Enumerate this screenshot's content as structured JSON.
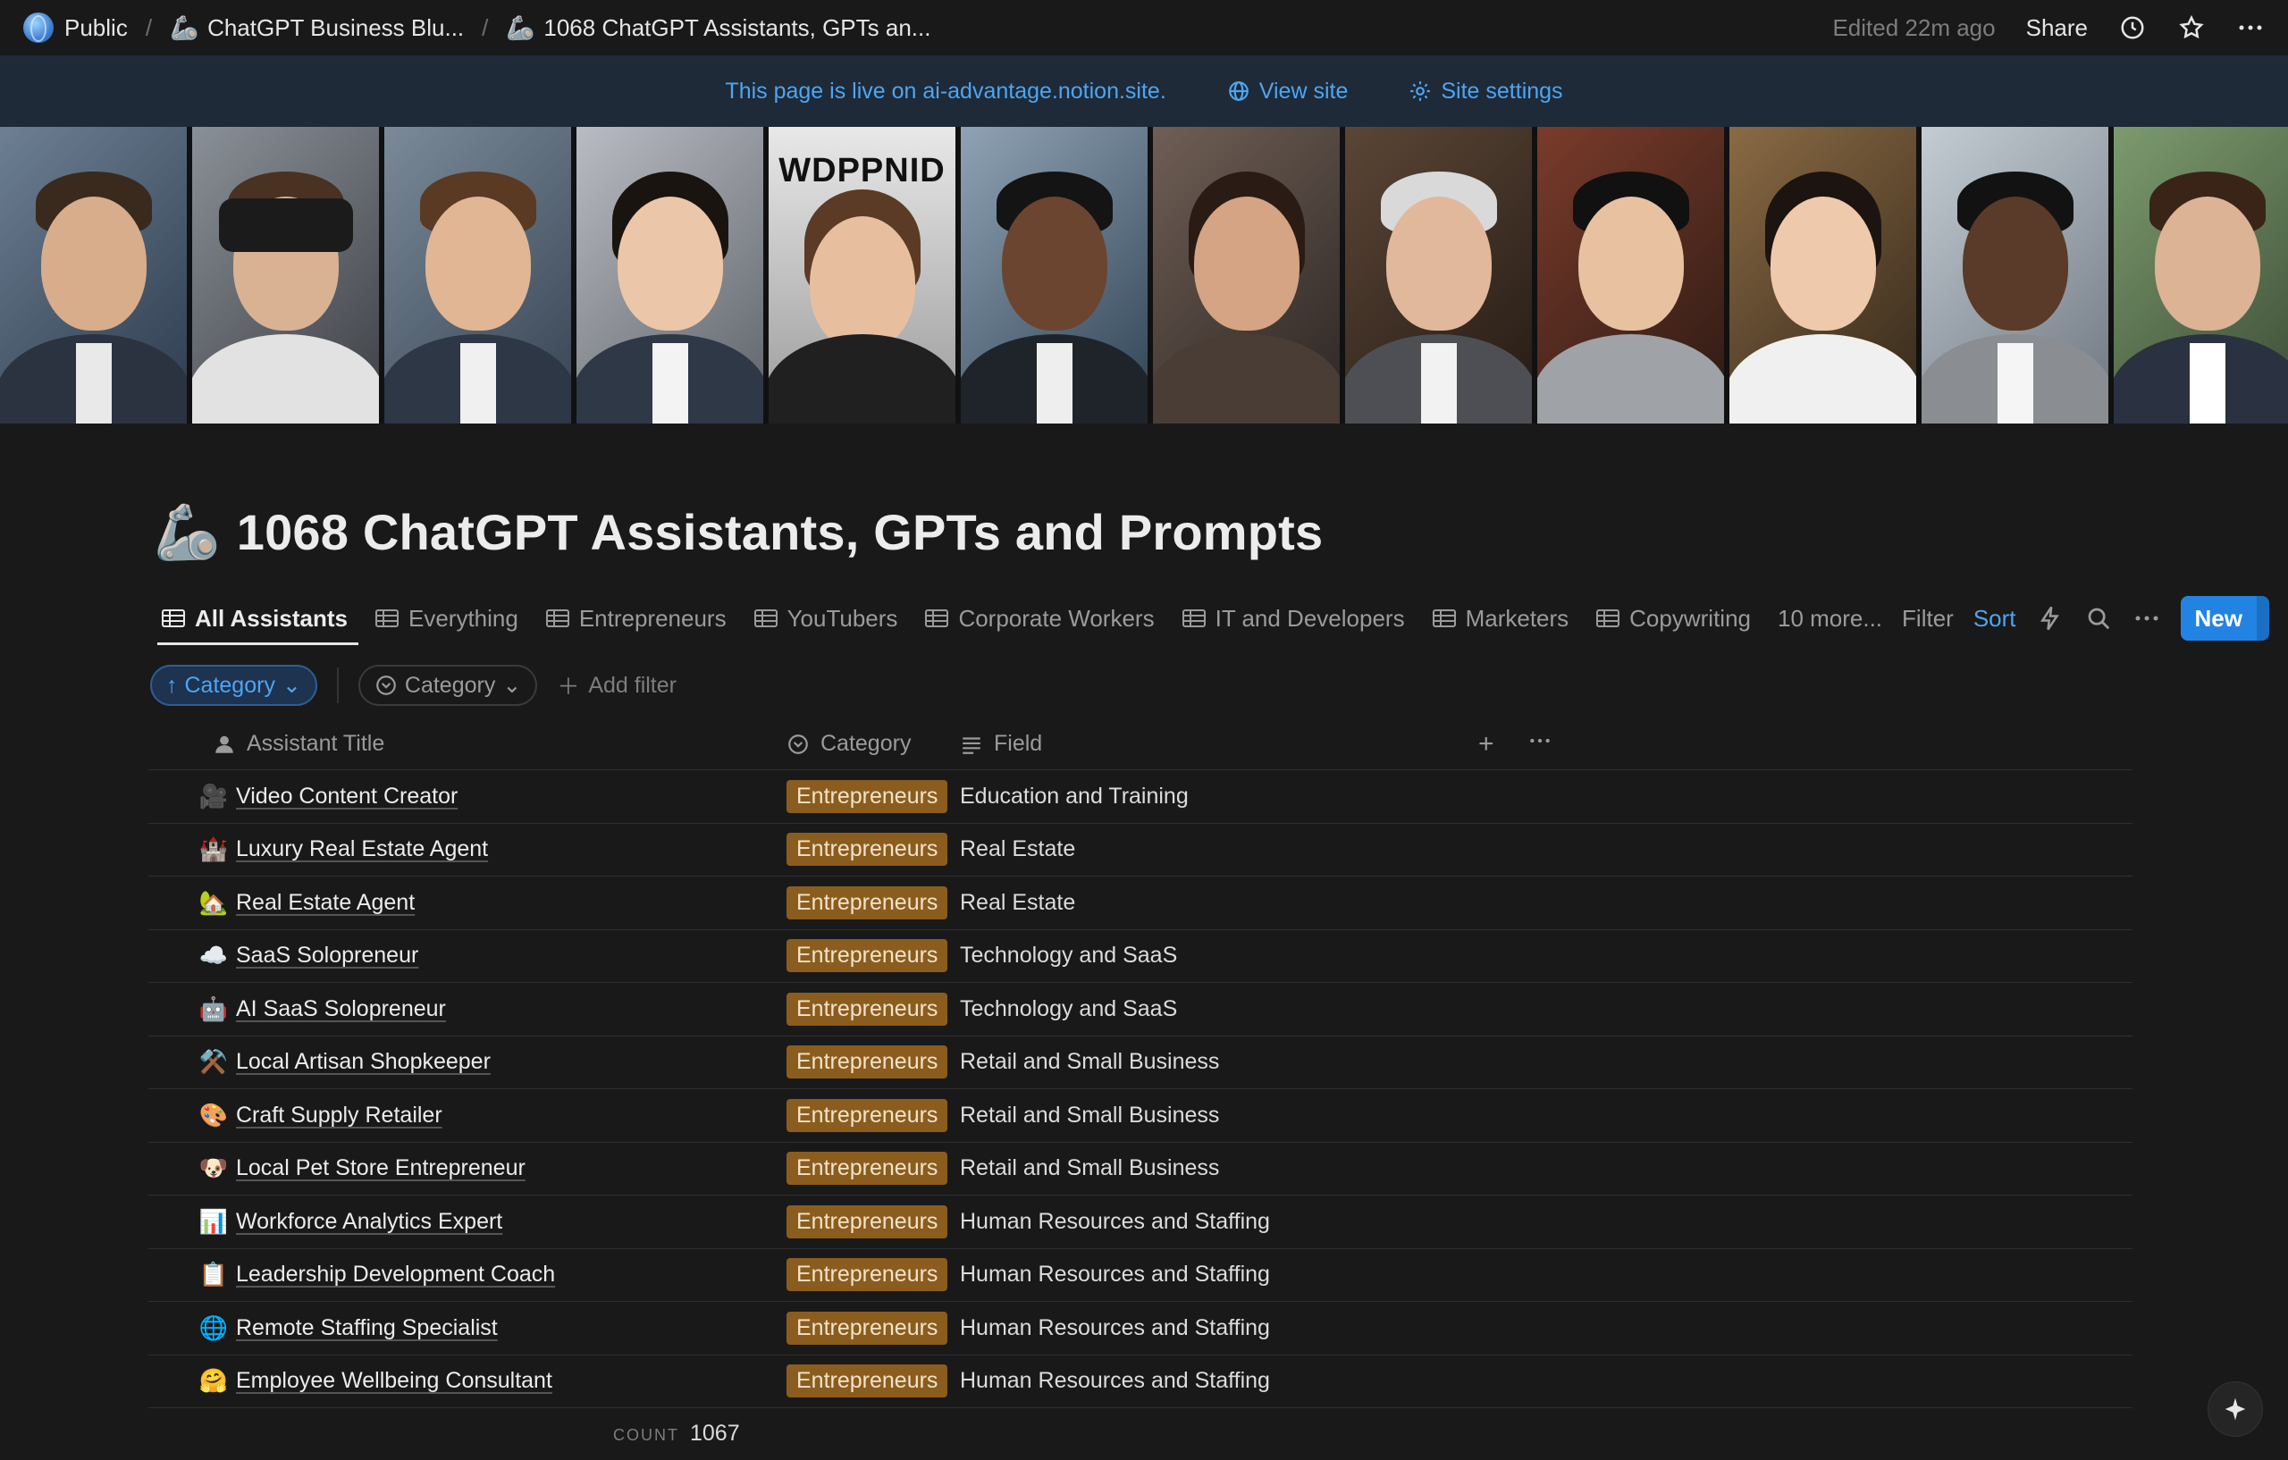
{
  "breadcrumbs": [
    {
      "emoji": "",
      "label": "Public"
    },
    {
      "emoji": "🦾",
      "label": "ChatGPT Business Blu..."
    },
    {
      "emoji": "🦾",
      "label": "1068 ChatGPT Assistants, GPTs an..."
    }
  ],
  "topbar": {
    "edited": "Edited 22m ago",
    "share_label": "Share"
  },
  "livebar": {
    "message": "This page is live on ai-advantage.notion.site.",
    "view_site": "View site",
    "site_settings": "Site settings"
  },
  "cover": {
    "wordmark": "WDPPNID"
  },
  "page": {
    "emoji": "🦾",
    "title": "1068 ChatGPT Assistants, GPTs and Prompts"
  },
  "tabs": [
    {
      "label": "All Assistants",
      "active": true
    },
    {
      "label": "Everything"
    },
    {
      "label": "Entrepreneurs"
    },
    {
      "label": "YouTubers"
    },
    {
      "label": "Corporate Workers"
    },
    {
      "label": "IT and Developers"
    },
    {
      "label": "Marketers"
    },
    {
      "label": "Copywriting"
    }
  ],
  "tab_actions": {
    "more": "10 more...",
    "filter": "Filter",
    "sort": "Sort",
    "new": "New"
  },
  "filters": {
    "sort_chip": "Category",
    "filter_chip": "Category",
    "add_filter": "Add filter"
  },
  "columns": {
    "title": "Assistant Title",
    "category": "Category",
    "field": "Field"
  },
  "rows": [
    {
      "emoji": "🎥",
      "title": "Video Content Creator",
      "category": "Entrepreneurs",
      "field": "Education and Training"
    },
    {
      "emoji": "🏰",
      "title": "Luxury Real Estate Agent",
      "category": "Entrepreneurs",
      "field": "Real Estate"
    },
    {
      "emoji": "🏡",
      "title": "Real Estate Agent",
      "category": "Entrepreneurs",
      "field": "Real Estate"
    },
    {
      "emoji": "☁️",
      "title": "SaaS Solopreneur",
      "category": "Entrepreneurs",
      "field": "Technology and SaaS"
    },
    {
      "emoji": "🤖",
      "title": "AI SaaS Solopreneur",
      "category": "Entrepreneurs",
      "field": "Technology and SaaS"
    },
    {
      "emoji": "⚒️",
      "title": "Local Artisan Shopkeeper",
      "category": "Entrepreneurs",
      "field": "Retail and Small Business"
    },
    {
      "emoji": "🎨",
      "title": "Craft Supply Retailer",
      "category": "Entrepreneurs",
      "field": "Retail and Small Business"
    },
    {
      "emoji": "🐶",
      "title": "Local Pet Store Entrepreneur",
      "category": "Entrepreneurs",
      "field": "Retail and Small Business"
    },
    {
      "emoji": "📊",
      "title": "Workforce Analytics Expert",
      "category": "Entrepreneurs",
      "field": "Human Resources and Staffing"
    },
    {
      "emoji": "📋",
      "title": "Leadership Development Coach",
      "category": "Entrepreneurs",
      "field": "Human Resources and Staffing"
    },
    {
      "emoji": "🌐",
      "title": "Remote Staffing Specialist",
      "category": "Entrepreneurs",
      "field": "Human Resources and Staffing"
    },
    {
      "emoji": "🤗",
      "title": "Employee Wellbeing Consultant",
      "category": "Entrepreneurs",
      "field": "Human Resources and Staffing"
    }
  ],
  "footer": {
    "count_label": "COUNT",
    "count_value": "1067"
  },
  "colors": {
    "accent": "#2383e2",
    "tag_bg": "#8a5d1f",
    "banner_bg": "#1e2a38"
  }
}
